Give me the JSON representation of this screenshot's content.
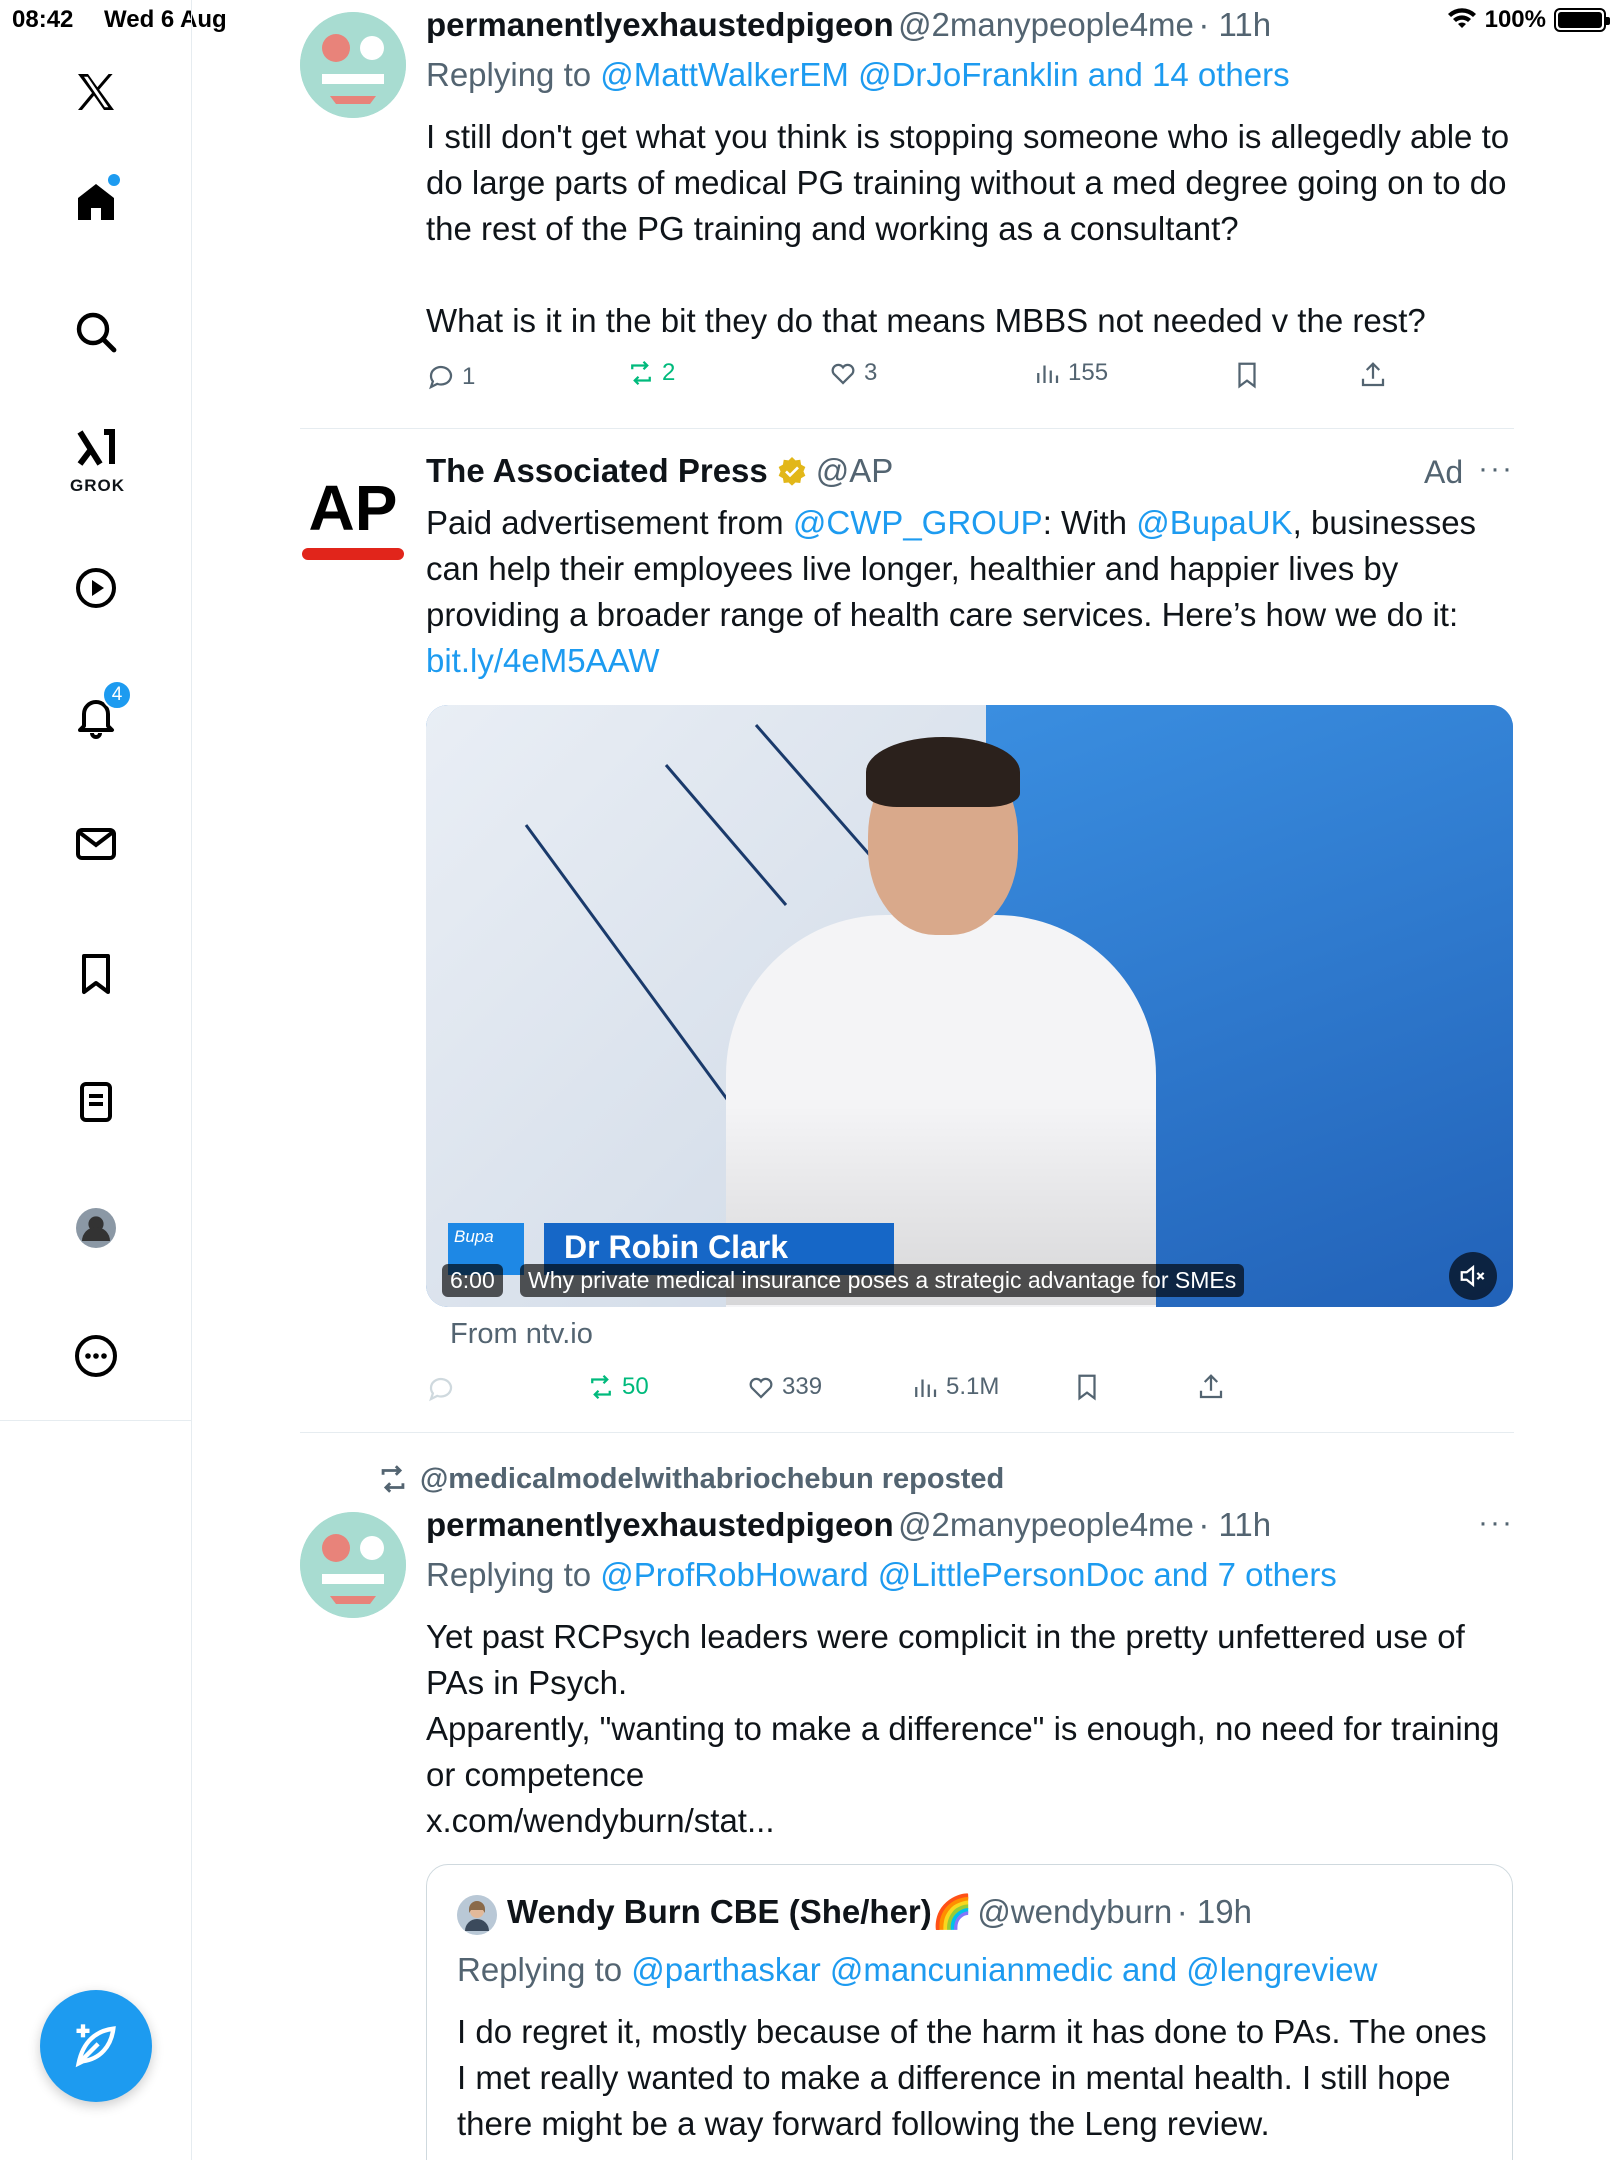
{
  "status_bar": {
    "time": "08:42",
    "date": "Wed 6 Aug",
    "battery": "100%"
  },
  "sidebar": {
    "items": [
      {
        "name": "x-logo-icon"
      },
      {
        "name": "home-icon"
      },
      {
        "name": "search-icon"
      },
      {
        "name": "grok-icon",
        "label": "GROK"
      },
      {
        "name": "video-icon"
      },
      {
        "name": "notifications-icon",
        "badge": "4"
      },
      {
        "name": "messages-icon"
      },
      {
        "name": "bookmarks-icon"
      },
      {
        "name": "lists-icon"
      },
      {
        "name": "profile-icon"
      },
      {
        "name": "more-icon"
      }
    ],
    "compose": "compose-icon"
  },
  "tweet1": {
    "name": "permanentlyexhaustedpigeon",
    "handle": "@2manypeople4me",
    "time": "· 11h",
    "replying_prefix": "Replying to",
    "replying_to": "@MattWalkerEM @DrJoFranklin and 14 others",
    "text_p1": "I still don't get what you think is stopping someone who is allegedly able to do large parts of medical PG training without a med degree going on to do the rest of the PG training and working as a consultant?",
    "text_p2": "What is it in the bit they do that means MBBS not needed v the rest?",
    "replies": "1",
    "reposts": "2",
    "likes": "3",
    "views": "155"
  },
  "ad": {
    "name": "The Associated Press",
    "handle": "@AP",
    "ad_label": "Ad",
    "more": "···",
    "text_prefix": "Paid advertisement from ",
    "mention1": "@CWP_GROUP",
    "text_mid1": ": With ",
    "mention2": "@BupaUK",
    "text_mid2": ", businesses can help their employees live longer, healthier and happier lives by providing a broader range of health care services. Here’s how we do it: ",
    "link": "bit.ly/4eM5AAW",
    "video": {
      "logo": "Bupa",
      "lower_third": "Dr Robin Clark",
      "duration": "6:00",
      "caption": "Why private medical insurance poses a strategic advantage for SMEs"
    },
    "source": "From ntv.io",
    "reposts": "50",
    "likes": "339",
    "views": "5.1M"
  },
  "tweet3": {
    "repost_banner": "@medicalmodelwithabriochebun reposted",
    "name": "permanentlyexhaustedpigeon",
    "handle": "@2manypeople4me",
    "time": "· 11h",
    "more": "···",
    "replying_prefix": "Replying to",
    "replying_to": "@ProfRobHoward @LittlePersonDoc and 7 others",
    "text_l1": "Yet past RCPsych leaders were complicit in the pretty unfettered use of PAs in Psych.",
    "text_l2": "Apparently, \"wanting to make a difference\" is enough, no need for training or competence",
    "link": "x.com/wendyburn/stat...",
    "quote": {
      "name": "Wendy Burn CBE (She/her)🌈",
      "handle": "@wendyburn",
      "time": "· 19h",
      "replying_prefix": "Replying to",
      "replying_to": "@parthaskar @mancunianmedic and @lengreview",
      "text": "I do regret it, mostly because of the harm it has done to PAs. The ones I met really wanted to make a difference in mental health. I still hope there might be a way forward following the Leng review."
    }
  }
}
